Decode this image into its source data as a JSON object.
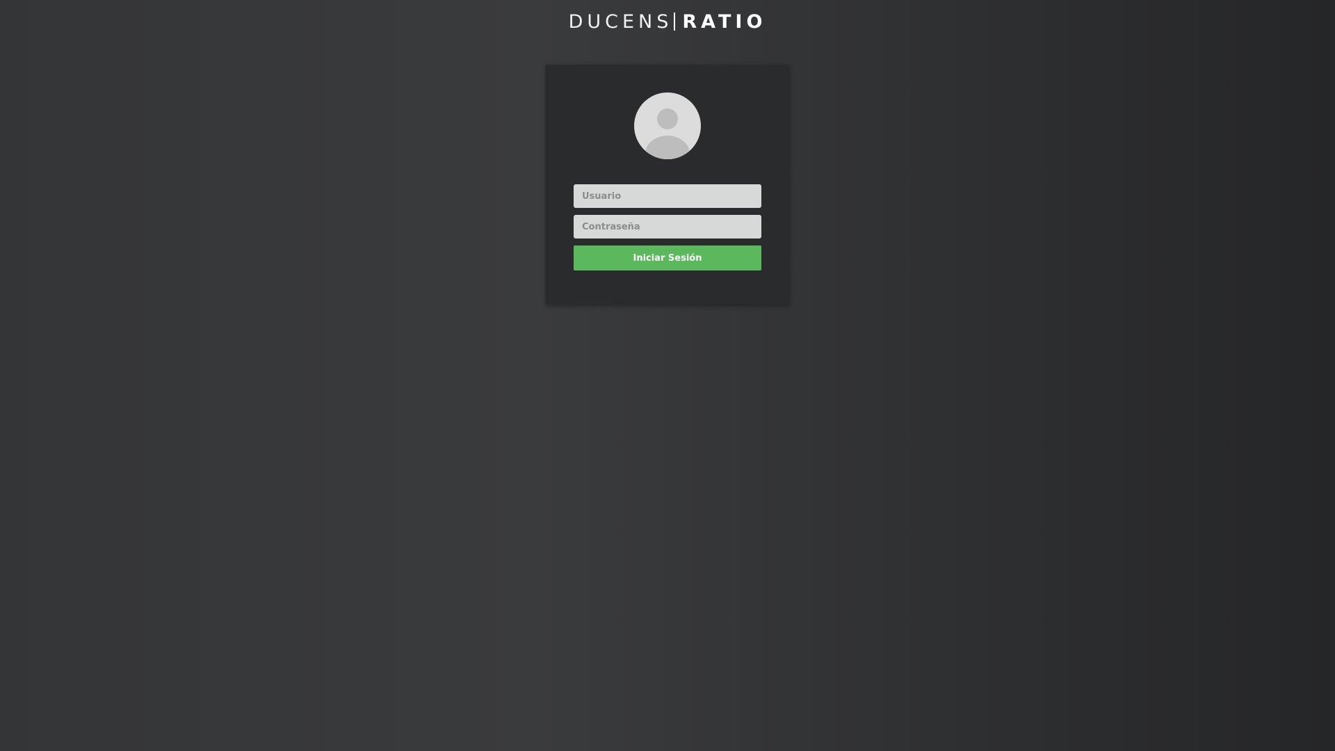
{
  "brand": {
    "light_text": "DUCENS",
    "bold_text": "RATIO"
  },
  "login": {
    "avatar_icon": "user-avatar-icon",
    "username": {
      "placeholder": "Usuario",
      "value": ""
    },
    "password": {
      "placeholder": "Contraseña",
      "value": ""
    },
    "submit_label": "Iniciar Sesión",
    "submit_color": "#5cb85c"
  }
}
